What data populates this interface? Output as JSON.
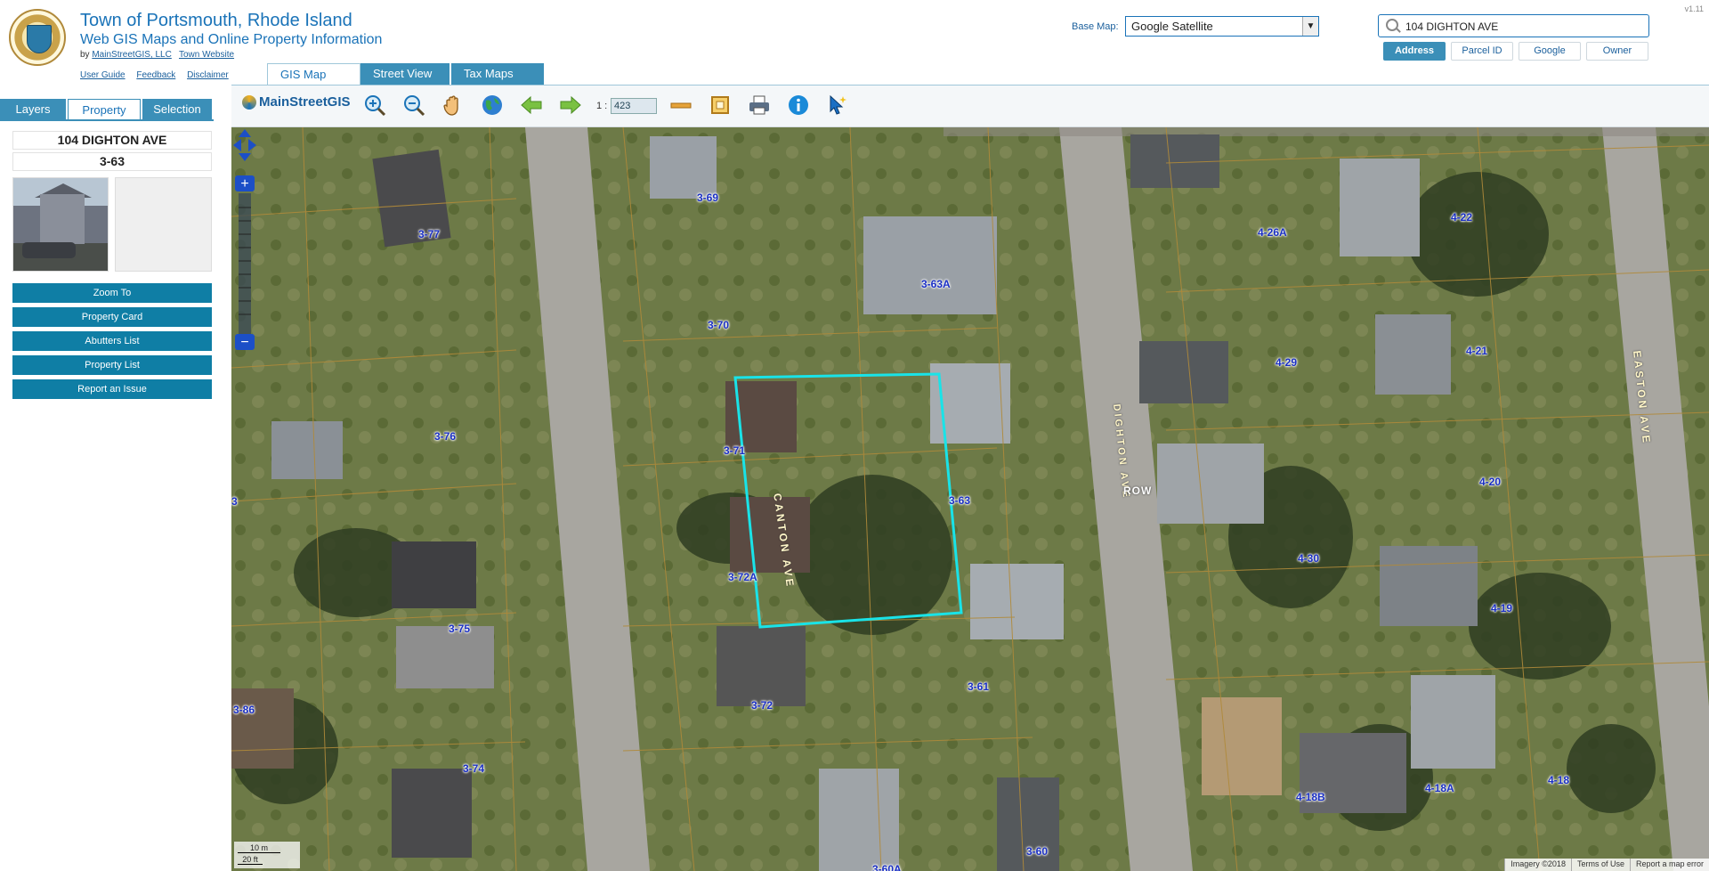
{
  "header": {
    "title": "Town of Portsmouth, Rhode Island",
    "subtitle": "Web GIS Maps and Online Property Information",
    "by_prefix": "by",
    "by_company": "MainStreetGIS, LLC",
    "town_website": "Town Website",
    "links": [
      "User Guide",
      "Feedback",
      "Disclaimer"
    ],
    "version": "v1.11"
  },
  "basemap": {
    "label": "Base Map:",
    "selected": "Google Satellite"
  },
  "search": {
    "value": "104 DIGHTON AVE",
    "types": [
      "Address",
      "Parcel ID",
      "Google",
      "Owner"
    ],
    "active_type": "Address"
  },
  "left_tabs": [
    "Layers",
    "Property",
    "Selection"
  ],
  "active_left_tab": "Property",
  "property": {
    "address": "104 DIGHTON AVE",
    "parcel_id": "3-63",
    "actions": [
      "Zoom To",
      "Property Card",
      "Abutters List",
      "Property List",
      "Report an Issue"
    ]
  },
  "map_tabs": [
    "GIS Map",
    "Street View",
    "Tax Maps"
  ],
  "active_map_tab": "GIS Map",
  "toolbar": {
    "logo": "MainStreetGIS",
    "scale_prefix": "1 :",
    "scale_value": "423",
    "tools": [
      "zoom-in-icon",
      "zoom-out-icon",
      "pan-hand-icon",
      "globe-icon",
      "back-arrow-icon",
      "forward-arrow-icon",
      "measure-icon",
      "extent-icon",
      "print-icon",
      "info-icon",
      "select-pointer-icon"
    ]
  },
  "map": {
    "parcel_labels": [
      "3-69",
      "3-77",
      "3-63A",
      "3-70",
      "3-76",
      "3-71",
      "3-63",
      "3-72A",
      "3-75",
      "3-72",
      "3-61",
      "3-86",
      "3-74",
      "3-60",
      "3-60A",
      "4-26A",
      "4-22",
      "4-29",
      "4-21",
      "4-20",
      "4-30",
      "4-19",
      "4-18B",
      "4-18A",
      "4-18",
      "3"
    ],
    "streets": [
      "CANTON AVE",
      "DIGHTON AVE",
      "ROW",
      "EASTON AVE"
    ],
    "scalebar": {
      "metric": "10 m",
      "imperial": "20 ft"
    },
    "attribution": [
      "Imagery ©2018",
      "Terms of Use",
      "Report a map error"
    ],
    "selection_color": "#19e3e8"
  },
  "colors": {
    "accent": "#1a73b8",
    "button": "#0f7ea5",
    "tab": "#3b8fb8",
    "label": "#1a2fc4"
  }
}
